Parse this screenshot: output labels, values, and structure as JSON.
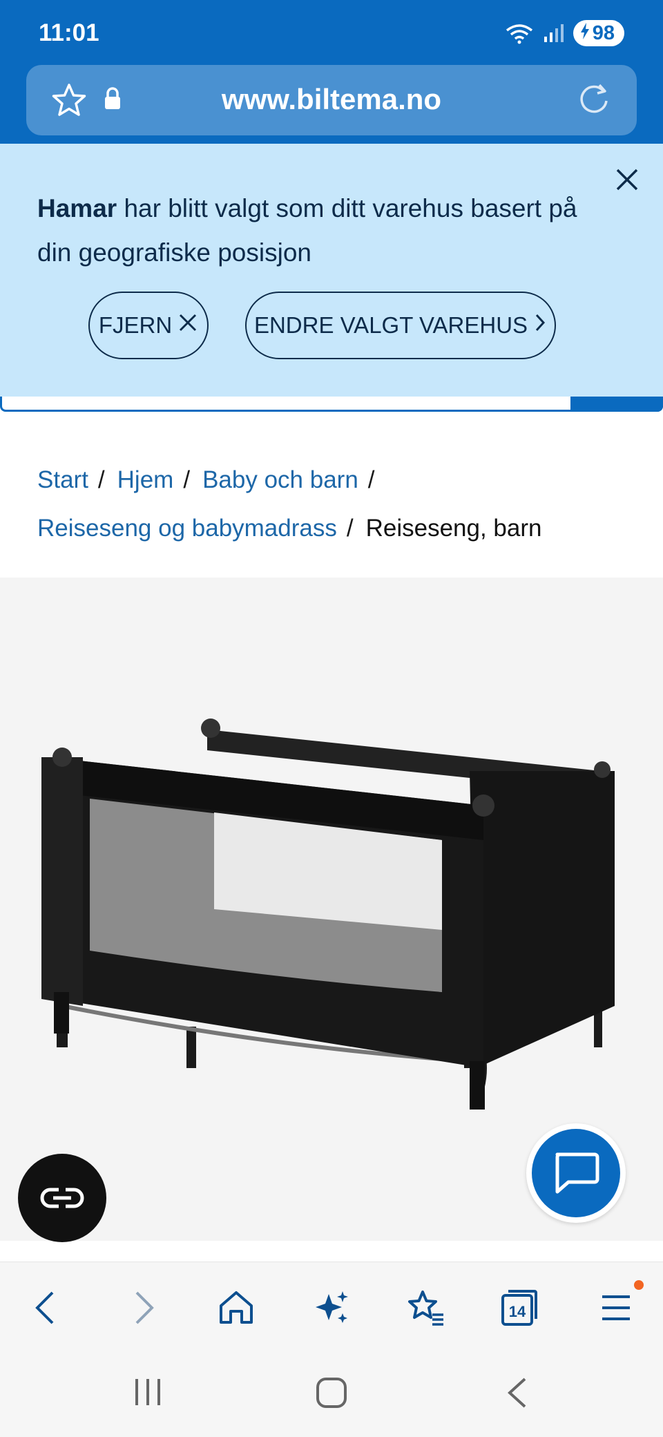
{
  "status_bar": {
    "time": "11:01",
    "battery": "98"
  },
  "browser": {
    "url": "www.biltema.no"
  },
  "store_notice": {
    "store_name": "Hamar",
    "message": " har blitt valgt som ditt varehus basert på din geografiske posisjon",
    "remove_label": "FJERN",
    "change_label": "ENDRE VALGT VAREHUS"
  },
  "breadcrumb": {
    "items": [
      "Start",
      "Hjem",
      "Baby och barn",
      "Reiseseng og babymadrass"
    ],
    "current": "Reiseseng, barn",
    "separator": "/"
  },
  "bottom_nav": {
    "tabs_count": "14"
  },
  "colors": {
    "brand_blue": "#0a6abf",
    "banner_bg": "#c7e7fb",
    "link": "#1d67a8",
    "notification": "#f26522"
  }
}
